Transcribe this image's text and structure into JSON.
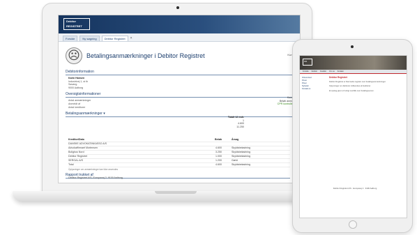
{
  "laptop": {
    "logo": {
      "line1": "Debitor",
      "line2": "REGISTRET"
    },
    "tabs": [
      {
        "label": "Forside"
      },
      {
        "label": "Ny søgning"
      },
      {
        "label": "Debitor Registret"
      }
    ],
    "title": "Betalingsanmærkninger i Debitor Registret",
    "company_right": "Kunde",
    "sections": {
      "debtor_info": "Debitorinformation",
      "overview": "Oversigtsinformationer",
      "payment_remarks": "Betalingsanmærkninger",
      "report": "Rapport trukket af"
    },
    "debtor_lines": [
      "Karin Hansen",
      "Industrivej 1, st th",
      "Søvang",
      "9000 Aalborg"
    ],
    "overview_lines": [
      "Antal anmærkninger",
      "Anmeldt af",
      "Antal kreditorer"
    ],
    "overview_right": [
      "Kunde i",
      "Beløb anmeldt",
      "CPR kontrolleret"
    ],
    "overview_values": [
      "Totalt 12 mdr.",
      "1",
      "4.600",
      "11.250"
    ],
    "table": {
      "head": [
        "Kreditor/Dato",
        "Beløb",
        "Årsag"
      ],
      "rows": [
        [
          "DANSKE ADVOKATINKASSO A/S",
          "",
          ""
        ],
        [
          "Advokatfirmaet Mortensen",
          "4.600",
          "Skyldsbelastning"
        ],
        [
          "Bolighus Nord",
          "3.250",
          "Skyldsbelastning"
        ],
        [
          "Debitor Registret",
          "1.000",
          "Skyldsbelastning"
        ],
        [
          "SERGAL A/S",
          "1.200",
          "Gæld"
        ],
        [
          "Total",
          "4.600",
          "Skyldsbelastning"
        ]
      ],
      "note": "Oplysninger om anmærkninger kan ikke anvendes"
    },
    "report_line": "Debitor Registret A/S, Europavej 2, 9100 Aalborg"
  },
  "tablet": {
    "logo": "DR",
    "nav": [
      "Forside",
      "Debitor",
      "Kreditor",
      "Om os",
      "Kontakt"
    ],
    "side": [
      "Virksomhed",
      "Privat",
      "Priser",
      "Nyheder",
      "Kontakt os"
    ],
    "heading": "Debitor Registret",
    "paragraphs": [
      "Debitor Registret er Danmarks register over betalingsanmærkninger.",
      "Oplysninger om debitorer indberettes af kreditorer.",
      "Et opslag giver et hurtigt overblik over betalingsevnen."
    ],
    "footer": "Debitor Registret A/S · Europavej 2 · 9100 Aalborg"
  }
}
